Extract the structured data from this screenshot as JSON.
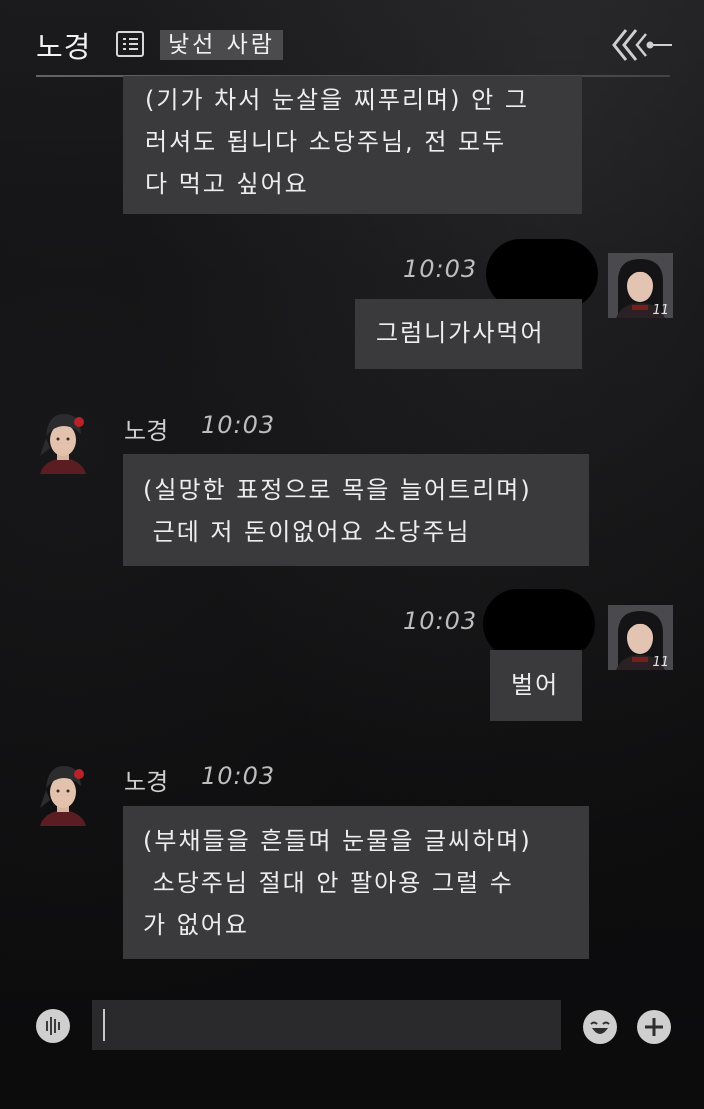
{
  "header": {
    "title": "노경",
    "relation": "낯선 사람",
    "list_icon": "list-icon",
    "back_icon": "back-arrow-icon"
  },
  "messages": [
    {
      "sender": "npc",
      "text": "(기가 차서 눈살을 찌푸리며) 안 그\n러셔도 됩니다 소당주님, 전 모두\n다 먹고 싶어요"
    },
    {
      "sender": "player",
      "time": "10:03",
      "level": "11",
      "text": "그럼니가사먹어"
    },
    {
      "sender": "npc",
      "name": "노경",
      "time": "10:03",
      "text": "(실망한 표정으로 목을 늘어트리며)\n 근데 저 돈이없어요 소당주님"
    },
    {
      "sender": "player",
      "time": "10:03",
      "level": "11",
      "text": "벌어"
    },
    {
      "sender": "npc",
      "name": "노경",
      "time": "10:03",
      "text": "(부채들을 흔들며 눈물을 글씨하며)\n 소당주님 절대 안 팔아용 그럴 수\n가 없어요"
    }
  ],
  "input": {
    "value": "",
    "voice_icon": "voice-wave-icon",
    "emoji_icon": "emoji-icon",
    "plus_icon": "plus-icon"
  },
  "colors": {
    "background": "#0e0e0f",
    "bubble": "#3a3a3c",
    "relation_badge": "#4b4b4e",
    "redaction": "#000000"
  }
}
